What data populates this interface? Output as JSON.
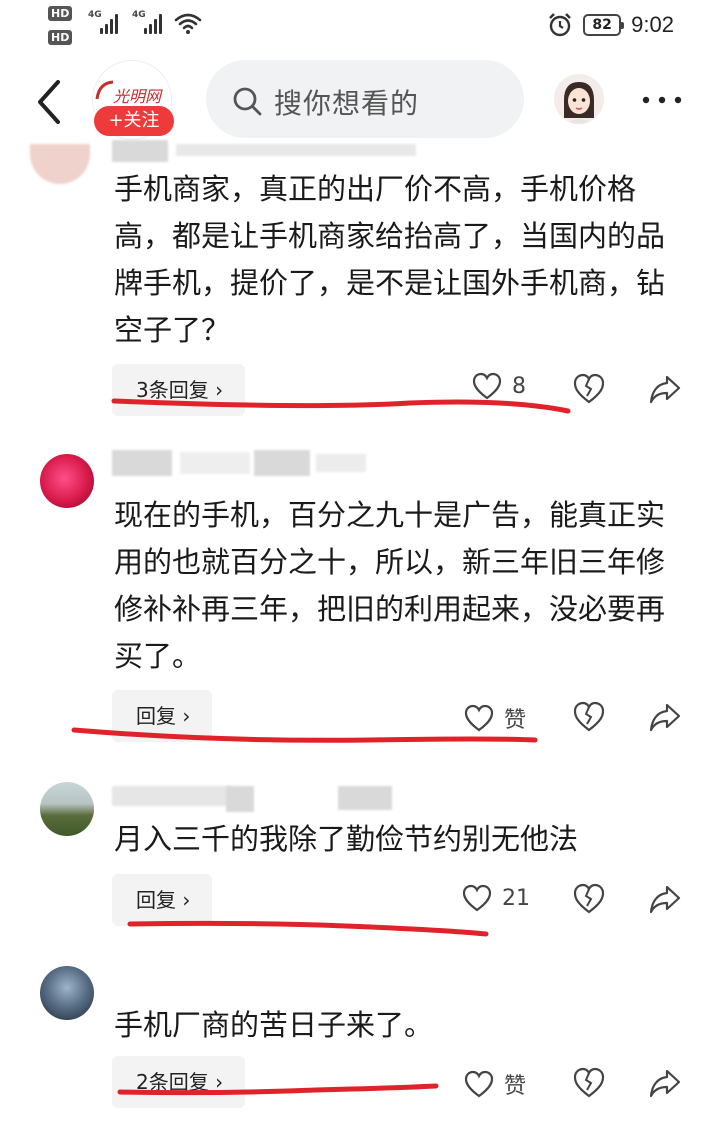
{
  "status_bar": {
    "hd1": "HD",
    "hd2": "HD",
    "net1": "4G",
    "net2": "4G",
    "battery": "82",
    "time": "9:02"
  },
  "header": {
    "brand_logo": "光明网",
    "follow_label": "+关注",
    "search_placeholder": "搜你想看的"
  },
  "comments": [
    {
      "text": "手机商家，真正的出厂价不高，手机价格高，都是让手机商家给抬高了，当国内的品牌手机，提价了，是不是让国外手机商，钻空子了？",
      "reply_label": "3条回复 ›",
      "like_value": "8"
    },
    {
      "text": "现在的手机，百分之九十是广告，能真正实用的也就百分之十，所以，新三年旧三年修修补补再三年，把旧的利用起来，没必要再买了。",
      "reply_label": "回复 ›",
      "like_value": "赞"
    },
    {
      "text": "月入三千的我除了勤俭节约别无他法",
      "reply_label": "回复 ›",
      "like_value": "21"
    },
    {
      "text": "手机厂商的苦日子来了。",
      "reply_label": "2条回复 ›",
      "like_value": "赞"
    }
  ],
  "colors": {
    "accent": "#ee3a3a",
    "annotation": "#e0232b"
  },
  "icons": [
    "back-icon",
    "search-icon",
    "more-icon",
    "heart-icon",
    "broken-heart-icon",
    "share-icon"
  ]
}
